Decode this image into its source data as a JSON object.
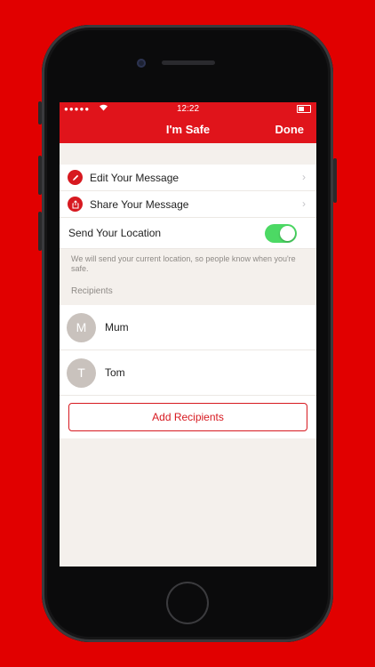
{
  "status": {
    "time": "12:22",
    "signal": "●●●●●",
    "wifi": "wifi-icon"
  },
  "nav": {
    "title": "I'm Safe",
    "done": "Done"
  },
  "settings": {
    "edit": "Edit Your Message",
    "share": "Share Your Message",
    "location": "Send Your Location",
    "location_enabled": true,
    "note": "We will send your current location, so people know when you're safe."
  },
  "recipients": {
    "header": "Recipients",
    "items": [
      {
        "initial": "M",
        "name": "Mum"
      },
      {
        "initial": "T",
        "name": "Tom"
      }
    ],
    "add": "Add Recipients"
  },
  "colors": {
    "background": "#e10000",
    "accent": "#d71920",
    "toggle_on": "#4cd964"
  }
}
